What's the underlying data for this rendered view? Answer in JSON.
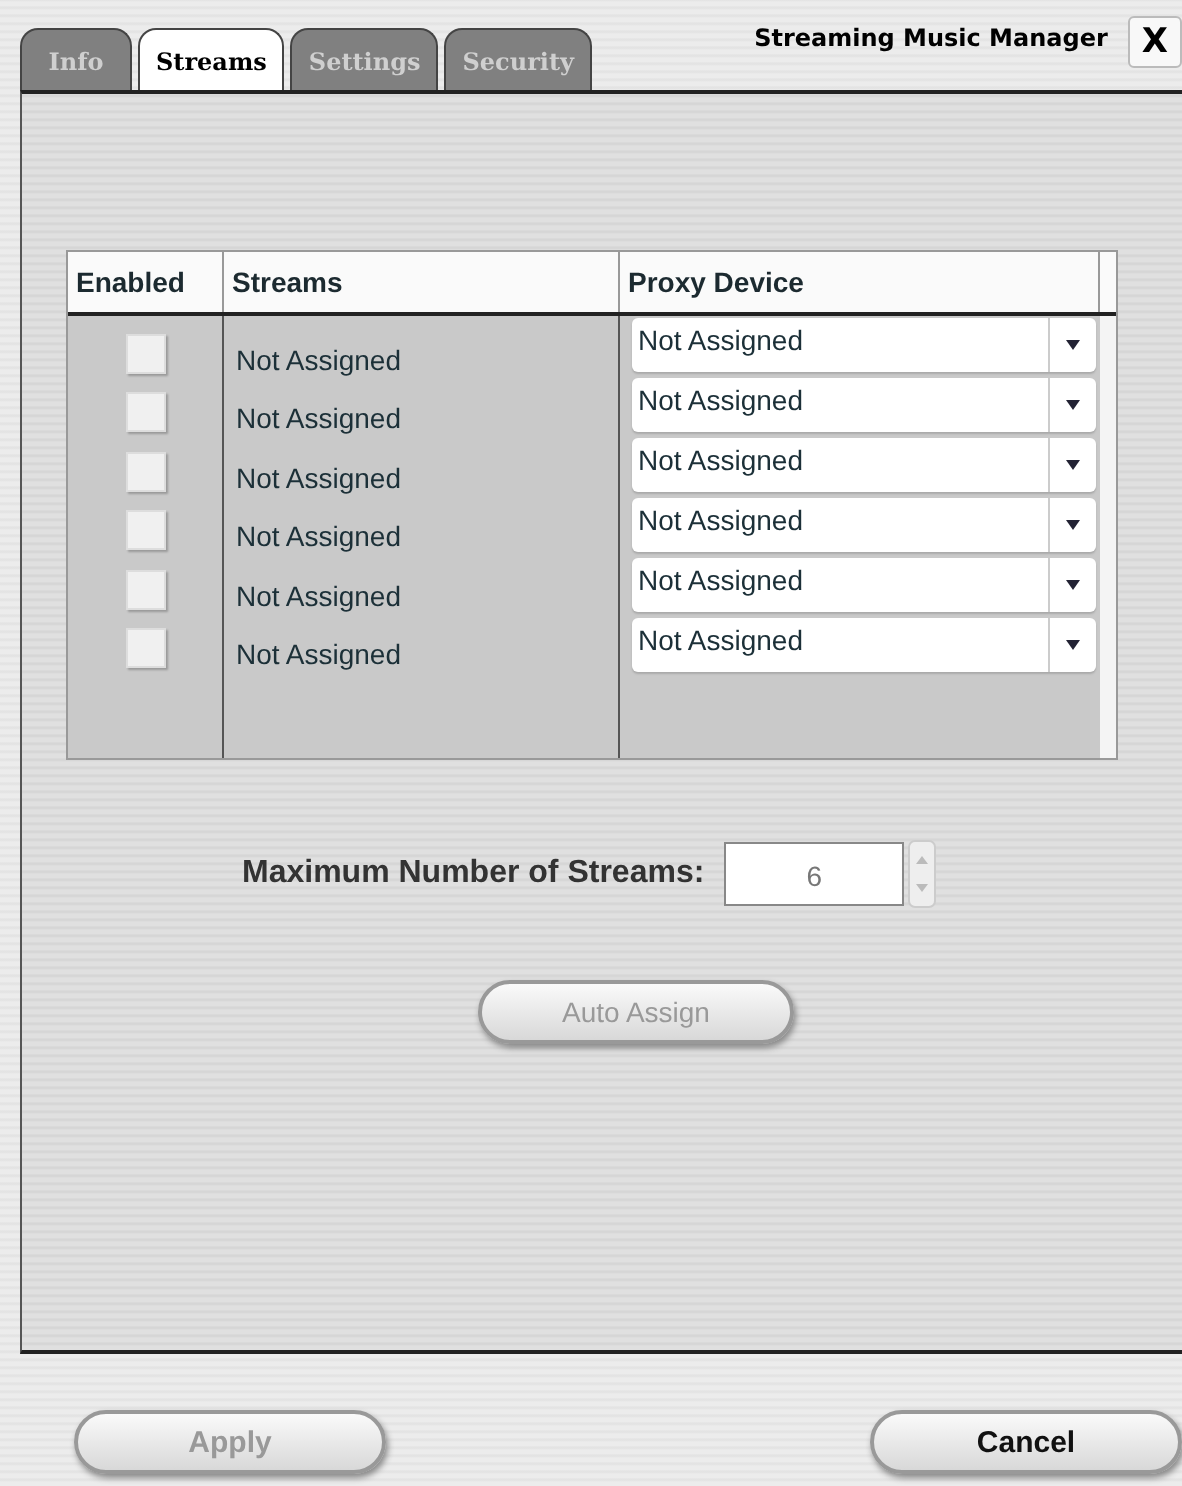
{
  "window": {
    "title": "Streaming Music Manager",
    "close": "X"
  },
  "tabs": [
    {
      "label": "Info",
      "selected": false
    },
    {
      "label": "Streams",
      "selected": true
    },
    {
      "label": "Settings",
      "selected": false
    },
    {
      "label": "Security",
      "selected": false
    }
  ],
  "table": {
    "columns": [
      "Enabled",
      "Streams",
      "Proxy Device"
    ],
    "rows": [
      {
        "enabled": false,
        "stream": "Not Assigned",
        "proxy": "Not Assigned"
      },
      {
        "enabled": false,
        "stream": "Not Assigned",
        "proxy": "Not Assigned"
      },
      {
        "enabled": false,
        "stream": "Not Assigned",
        "proxy": "Not Assigned"
      },
      {
        "enabled": false,
        "stream": "Not Assigned",
        "proxy": "Not Assigned"
      },
      {
        "enabled": false,
        "stream": "Not Assigned",
        "proxy": "Not Assigned"
      },
      {
        "enabled": false,
        "stream": "Not Assigned",
        "proxy": "Not Assigned"
      }
    ]
  },
  "max_streams": {
    "label": "Maximum Number of Streams:",
    "value": "6",
    "disabled": true
  },
  "auto_assign": {
    "label": "Auto Assign",
    "disabled": true
  },
  "buttons": [
    {
      "label": "Apply",
      "disabled": true
    },
    {
      "label": "Cancel",
      "disabled": false
    }
  ]
}
